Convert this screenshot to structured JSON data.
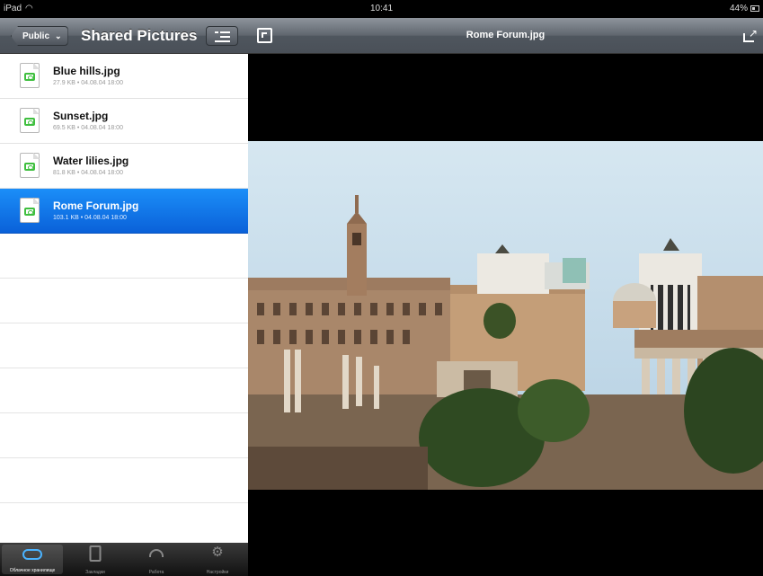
{
  "status_bar": {
    "device": "iPad",
    "time": "10:41",
    "battery": "44%"
  },
  "left": {
    "back_button": "Public",
    "title": "Shared Pictures",
    "files": [
      {
        "name": "Blue hills.jpg",
        "meta": "27.9 KB • 04.08.04 18:00"
      },
      {
        "name": "Sunset.jpg",
        "meta": "69.5 KB • 04.08.04 18:00"
      },
      {
        "name": "Water lilies.jpg",
        "meta": "81.8 KB • 04.08.04 18:00"
      },
      {
        "name": "Rome Forum.jpg",
        "meta": "103.1 KB • 04.08.04 18:00"
      }
    ],
    "selected_index": 3
  },
  "tabbar": {
    "tabs": [
      {
        "label": "Облачное хранилище",
        "icon": "cloud-icon",
        "active": true
      },
      {
        "label": "Закладки",
        "icon": "tablet-icon",
        "active": false
      },
      {
        "label": "Работа",
        "icon": "gauge-icon",
        "active": false
      },
      {
        "label": "Настройки",
        "icon": "gear-icon",
        "active": false
      }
    ]
  },
  "viewer": {
    "title": "Rome Forum.jpg"
  },
  "colors": {
    "selection": "#1584f0",
    "file_icon_accent": "#3fbf3f",
    "active_tab_icon": "#4ab3ff"
  }
}
